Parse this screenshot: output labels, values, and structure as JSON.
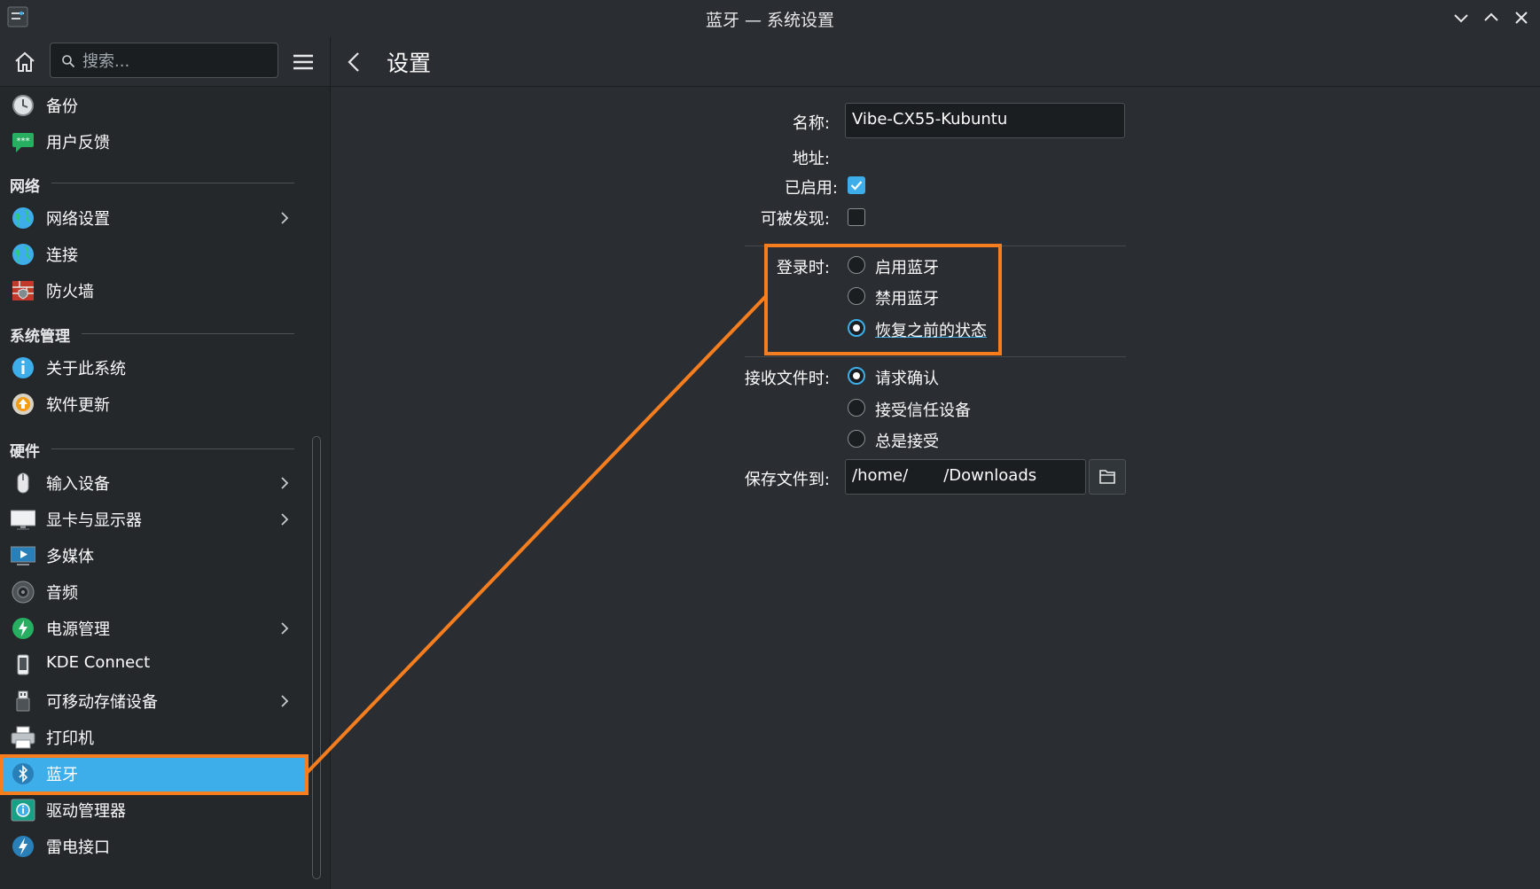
{
  "window": {
    "title": "蓝牙 — 系统设置"
  },
  "header": {
    "search_placeholder": "搜索...",
    "page_title": "设置"
  },
  "sidebar": {
    "items_top": [
      {
        "label": "备份",
        "icon": "clock-icon"
      },
      {
        "label": "用户反馈",
        "icon": "feedback-icon"
      }
    ],
    "categories": [
      {
        "title": "网络",
        "items": [
          {
            "label": "网络设置",
            "icon": "globe-icon",
            "chevron": true
          },
          {
            "label": "连接",
            "icon": "globe-icon"
          },
          {
            "label": "防火墙",
            "icon": "firewall-icon"
          }
        ]
      },
      {
        "title": "系统管理",
        "items": [
          {
            "label": "关于此系统",
            "icon": "info-icon"
          },
          {
            "label": "软件更新",
            "icon": "update-icon"
          }
        ]
      },
      {
        "title": "硬件",
        "items": [
          {
            "label": "输入设备",
            "icon": "mouse-icon",
            "chevron": true
          },
          {
            "label": "显卡与显示器",
            "icon": "monitor-icon",
            "chevron": true
          },
          {
            "label": "多媒体",
            "icon": "multimedia-icon"
          },
          {
            "label": "音频",
            "icon": "speaker-icon"
          },
          {
            "label": "电源管理",
            "icon": "power-icon",
            "chevron": true
          },
          {
            "label": "KDE Connect",
            "icon": "phone-icon"
          },
          {
            "label": "可移动存储设备",
            "icon": "usb-icon",
            "chevron": true
          },
          {
            "label": "打印机",
            "icon": "printer-icon"
          },
          {
            "label": "蓝牙",
            "icon": "bluetooth-icon",
            "active": true
          },
          {
            "label": "驱动管理器",
            "icon": "driver-icon"
          },
          {
            "label": "雷电接口",
            "icon": "thunderbolt-icon"
          }
        ]
      }
    ]
  },
  "settings": {
    "name_label": "名称:",
    "name_value": "Vibe-CX55-Kubuntu",
    "address_label": "地址:",
    "enabled_label": "已启用:",
    "enabled": true,
    "discoverable_label": "可被发现:",
    "discoverable": false,
    "login_label": "登录时:",
    "login_options": [
      "启用蓝牙",
      "禁用蓝牙",
      "恢复之前的状态"
    ],
    "login_selected": 2,
    "receive_label": "接收文件时:",
    "receive_options": [
      "请求确认",
      "接受信任设备",
      "总是接受"
    ],
    "receive_selected": 0,
    "save_label": "保存文件到:",
    "save_path": "/home/       /Downloads"
  },
  "colors": {
    "accent": "#3daee9",
    "highlight": "#f67e1f",
    "window_bg": "#2a2e32",
    "sidebar_bg": "#24282b"
  }
}
